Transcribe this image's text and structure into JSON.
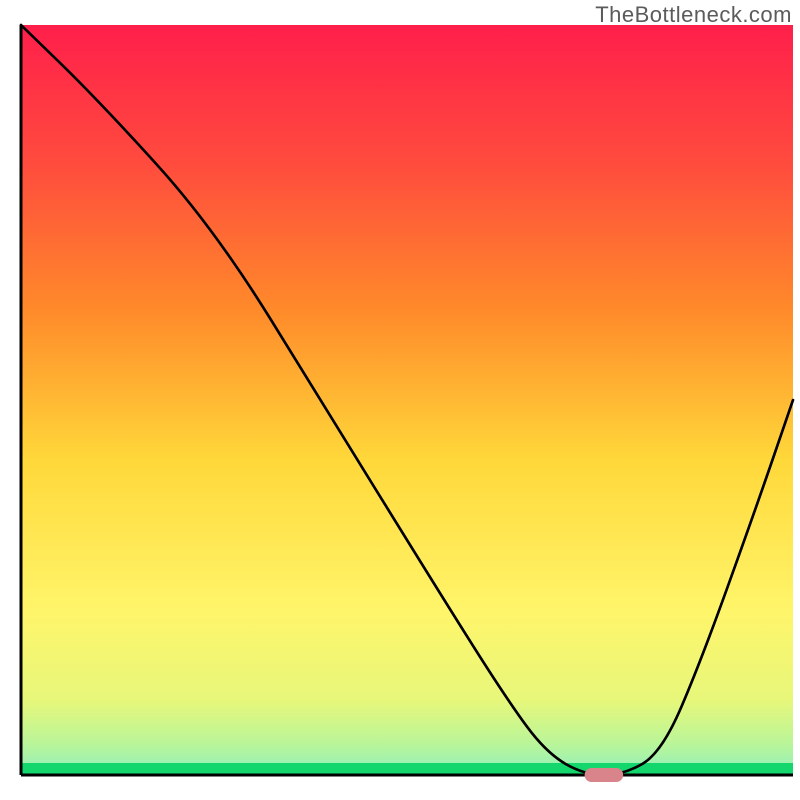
{
  "watermark": "TheBottleneck.com",
  "chart_data": {
    "type": "line",
    "title": "",
    "xlabel": "",
    "ylabel": "",
    "xlim": [
      0,
      100
    ],
    "ylim": [
      0,
      100
    ],
    "grid": false,
    "legend": null,
    "series": [
      {
        "name": "curve",
        "x": [
          0,
          10,
          25,
          40,
          55,
          63,
          68,
          73,
          78,
          83,
          88,
          95,
          100
        ],
        "y": [
          100,
          90,
          73,
          48,
          23,
          10,
          3,
          0,
          0,
          3,
          15,
          35,
          50
        ]
      }
    ],
    "marker": {
      "name": "recommended-range",
      "x_start": 73,
      "x_end": 78,
      "y": 0,
      "color": "#d9848a"
    },
    "background_gradient": {
      "top": "#ff1f4b",
      "upper_mid": "#ff8a2a",
      "mid": "#ffd83a",
      "lower_mid": "#f3f47a",
      "low": "#c9f59a",
      "bottom_band": "#13d66d"
    }
  }
}
